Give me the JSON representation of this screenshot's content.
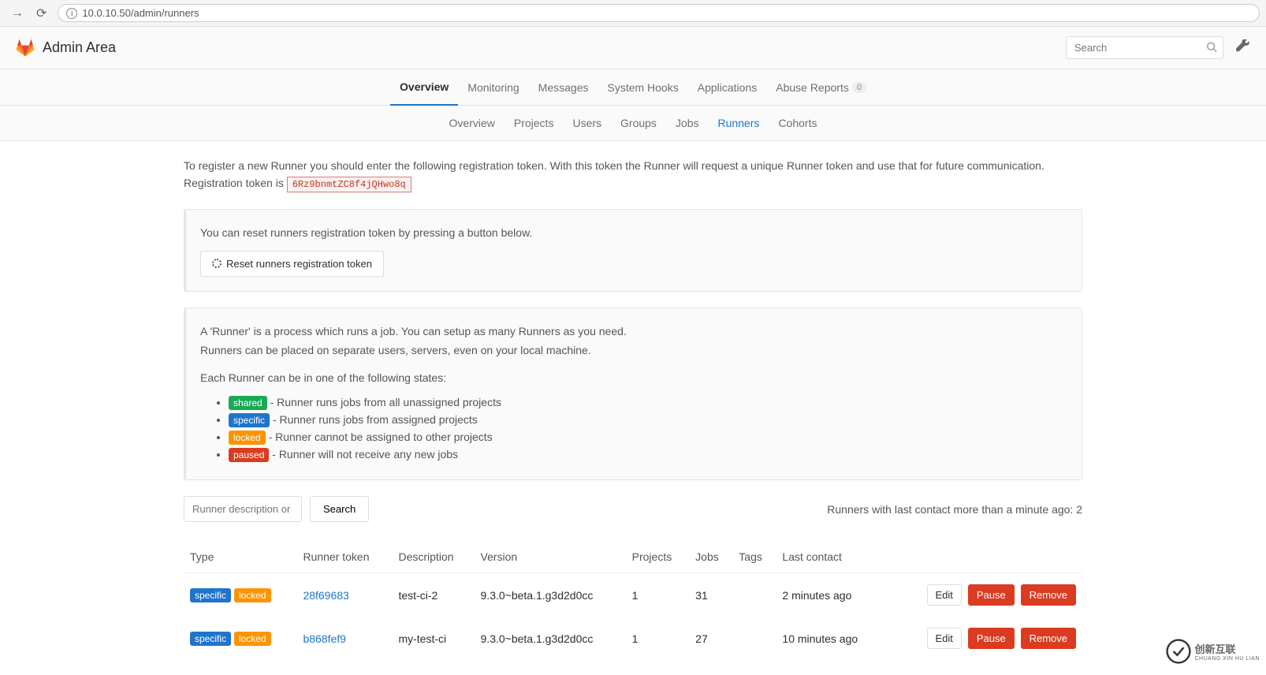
{
  "browser": {
    "url": "10.0.10.50/admin/runners"
  },
  "header": {
    "title": "Admin Area",
    "search_placeholder": "Search"
  },
  "nav_primary": {
    "items": [
      {
        "label": "Overview",
        "active": true
      },
      {
        "label": "Monitoring"
      },
      {
        "label": "Messages"
      },
      {
        "label": "System Hooks"
      },
      {
        "label": "Applications"
      },
      {
        "label": "Abuse Reports",
        "badge": "0"
      }
    ]
  },
  "nav_secondary": {
    "items": [
      {
        "label": "Overview"
      },
      {
        "label": "Projects"
      },
      {
        "label": "Users"
      },
      {
        "label": "Groups"
      },
      {
        "label": "Jobs"
      },
      {
        "label": "Runners",
        "active": true
      },
      {
        "label": "Cohorts"
      }
    ]
  },
  "intro": {
    "line1_pre": "To register a new Runner you should enter the following registration token. With this token the Runner will request a unique Runner token and use that for future communication.",
    "line2_label": "Registration token is ",
    "token": "6Rz9bnmtZC8f4jQHwo8q"
  },
  "reset_card": {
    "text": "You can reset runners registration token by pressing a button below.",
    "button": "Reset runners registration token"
  },
  "info_card": {
    "p1": "A 'Runner' is a process which runs a job. You can setup as many Runners as you need.",
    "p2": "Runners can be placed on separate users, servers, even on your local machine.",
    "p3": "Each Runner can be in one of the following states:",
    "states": [
      {
        "name": "shared",
        "class": "badge-shared",
        "desc": " - Runner runs jobs from all unassigned projects"
      },
      {
        "name": "specific",
        "class": "badge-specific",
        "desc": " - Runner runs jobs from assigned projects"
      },
      {
        "name": "locked",
        "class": "badge-locked",
        "desc": " - Runner cannot be assigned to other projects"
      },
      {
        "name": "paused",
        "class": "badge-paused",
        "desc": " - Runner will not receive any new jobs"
      }
    ]
  },
  "filter": {
    "placeholder": "Runner description or",
    "search_button": "Search",
    "status": "Runners with last contact more than a minute ago: 2"
  },
  "table": {
    "headers": [
      "Type",
      "Runner token",
      "Description",
      "Version",
      "Projects",
      "Jobs",
      "Tags",
      "Last contact",
      ""
    ],
    "actions": {
      "edit": "Edit",
      "pause": "Pause",
      "remove": "Remove"
    },
    "rows": [
      {
        "type_badges": [
          "specific",
          "locked"
        ],
        "token": "28f69683",
        "description": "test-ci-2",
        "version": "9.3.0~beta.1.g3d2d0cc",
        "projects": "1",
        "jobs": "31",
        "tags": "",
        "last_contact": "2 minutes ago"
      },
      {
        "type_badges": [
          "specific",
          "locked"
        ],
        "token": "b868fef9",
        "description": "my-test-ci",
        "version": "9.3.0~beta.1.g3d2d0cc",
        "projects": "1",
        "jobs": "27",
        "tags": "",
        "last_contact": "10 minutes ago"
      }
    ]
  },
  "watermark": {
    "line1": "创新互联",
    "line2": "CHUANG XIN HU LIAN"
  }
}
